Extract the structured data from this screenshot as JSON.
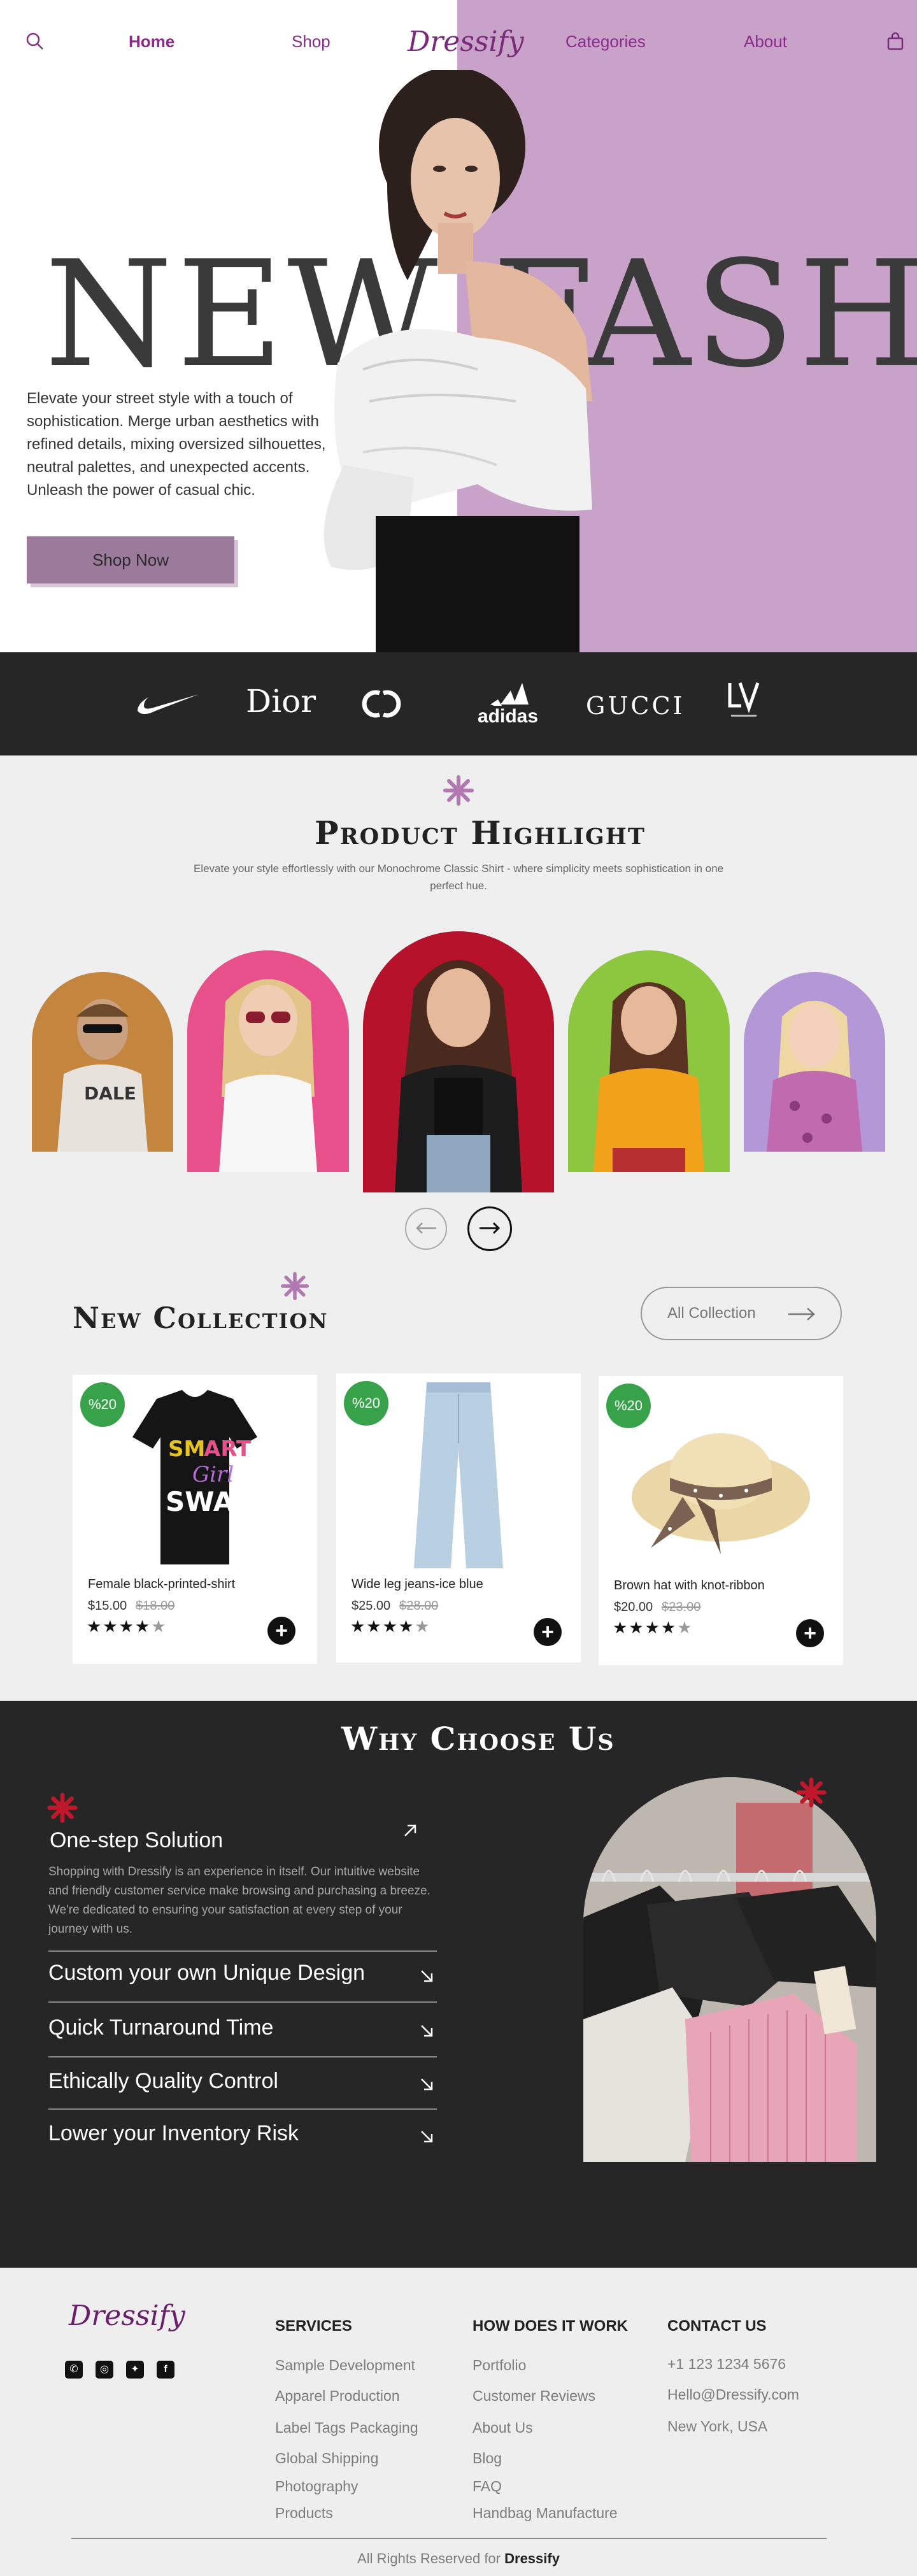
{
  "nav": {
    "home": "Home",
    "shop": "Shop",
    "logo": "Dressify",
    "categories": "Categories",
    "about": "About"
  },
  "hero": {
    "headline": "NEW FASHION",
    "description": "Elevate your street style with a touch of sophistication. Merge urban aesthetics with refined details, mixing oversized silhouettes, neutral palettes, and unexpected accents. Unleash the power of casual chic.",
    "cta": "Shop Now"
  },
  "brands": [
    "Nike",
    "Dior",
    "Chanel",
    "adidas",
    "GUCCI",
    "Louis Vuitton"
  ],
  "brand_text": {
    "dior": "Dior",
    "adidas": "adidas",
    "gucci": "GUCCI"
  },
  "highlight": {
    "title": "Product Highlight",
    "subtitle": "Elevate your style effortlessly with our Monochrome Classic Shirt - where simplicity meets sophistication in one perfect hue."
  },
  "collection": {
    "title": "New Collection",
    "all_button": "All Collection",
    "products": [
      {
        "badge": "%20",
        "name": "Female black-printed-shirt",
        "price": "$15.00",
        "old_price": "$18.00",
        "rating": 4
      },
      {
        "badge": "%20",
        "name": "Wide leg jeans-ice blue",
        "price": "$25.00",
        "old_price": "$28.00",
        "rating": 4
      },
      {
        "badge": "%20",
        "name": "Brown hat with knot-ribbon",
        "price": "$20.00",
        "old_price": "$23.00",
        "rating": 4
      }
    ]
  },
  "why": {
    "title": "Why Choose Us",
    "first": {
      "title": "One-step Solution",
      "text": "Shopping with Dressify is an experience in itself. Our intuitive website and friendly customer service make browsing and purchasing a breeze. We're dedicated to ensuring your satisfaction at every step of your journey with us."
    },
    "items": [
      "Custom your own Unique Design",
      "Quick Turnaround Time",
      "Ethically Quality Control",
      "Lower your Inventory Risk"
    ]
  },
  "footer": {
    "logo": "Dressify",
    "services_title": "SERVICES",
    "services": [
      "Sample Development",
      "Apparel Production",
      "Label Tags Packaging",
      "Global Shipping",
      "Photography",
      "Products"
    ],
    "how_title": "HOW DOES IT WORK",
    "how": [
      "Portfolio",
      "Customer Reviews",
      "About Us",
      "Blog",
      "FAQ",
      "Handbag Manufacture"
    ],
    "contact_title": "CONTACT US",
    "contact": [
      "+1 123 1234 5676",
      "Hello@Dressify.com",
      "New York, USA"
    ],
    "copyright_prefix": "All Rights Reserved for",
    "copyright_brand": "Dressify"
  },
  "colors": {
    "accent_purple": "#c9a2c9",
    "dark": "#262626",
    "badge_green": "#37a24a",
    "star_red": "#c0182a"
  }
}
